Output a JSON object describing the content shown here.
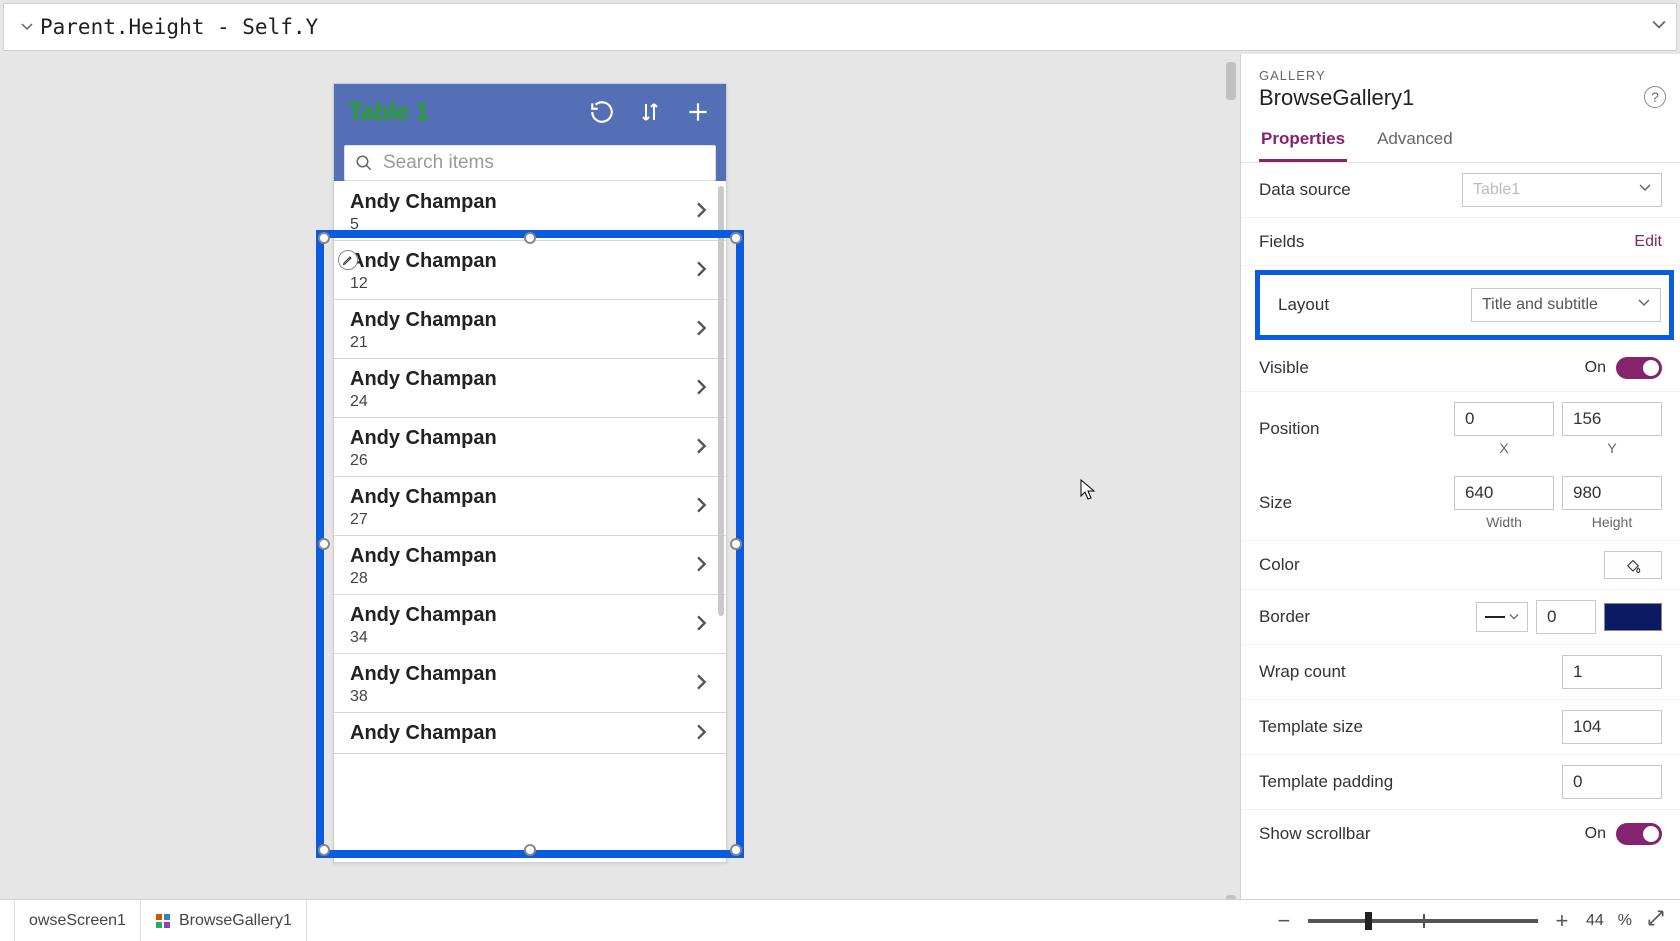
{
  "formula": "Parent.Height - Self.Y",
  "app": {
    "title": "Table 1",
    "search_placeholder": "Search items"
  },
  "gallery_items": [
    {
      "title": "Andy Champan",
      "sub": "5"
    },
    {
      "title": "Andy Champan",
      "sub": "12"
    },
    {
      "title": "Andy Champan",
      "sub": "21"
    },
    {
      "title": "Andy Champan",
      "sub": "24"
    },
    {
      "title": "Andy Champan",
      "sub": "26"
    },
    {
      "title": "Andy Champan",
      "sub": "27"
    },
    {
      "title": "Andy Champan",
      "sub": "28"
    },
    {
      "title": "Andy Champan",
      "sub": "34"
    },
    {
      "title": "Andy Champan",
      "sub": "38"
    },
    {
      "title": "Andy Champan",
      "sub": ""
    }
  ],
  "panel": {
    "type_label": "GALLERY",
    "name": "BrowseGallery1",
    "tabs": {
      "properties": "Properties",
      "advanced": "Advanced"
    },
    "help": "?",
    "data_source_label": "Data source",
    "data_source_value": "Table1",
    "fields_label": "Fields",
    "fields_edit": "Edit",
    "layout_label": "Layout",
    "layout_value": "Title and subtitle",
    "visible_label": "Visible",
    "visible_value": "On",
    "position_label": "Position",
    "position_x": "0",
    "position_y": "156",
    "x_lbl": "X",
    "y_lbl": "Y",
    "size_label": "Size",
    "size_w": "640",
    "size_h": "980",
    "w_lbl": "Width",
    "h_lbl": "Height",
    "color_label": "Color",
    "border_label": "Border",
    "border_width": "0",
    "wrap_label": "Wrap count",
    "wrap_value": "1",
    "tmpl_size_label": "Template size",
    "tmpl_size_value": "104",
    "tmpl_pad_label": "Template padding",
    "tmpl_pad_value": "0",
    "scroll_label": "Show scrollbar",
    "scroll_value": "On"
  },
  "status": {
    "crumb1": "owseScreen1",
    "crumb2": "BrowseGallery1",
    "zoom": "44",
    "pct": "%"
  }
}
